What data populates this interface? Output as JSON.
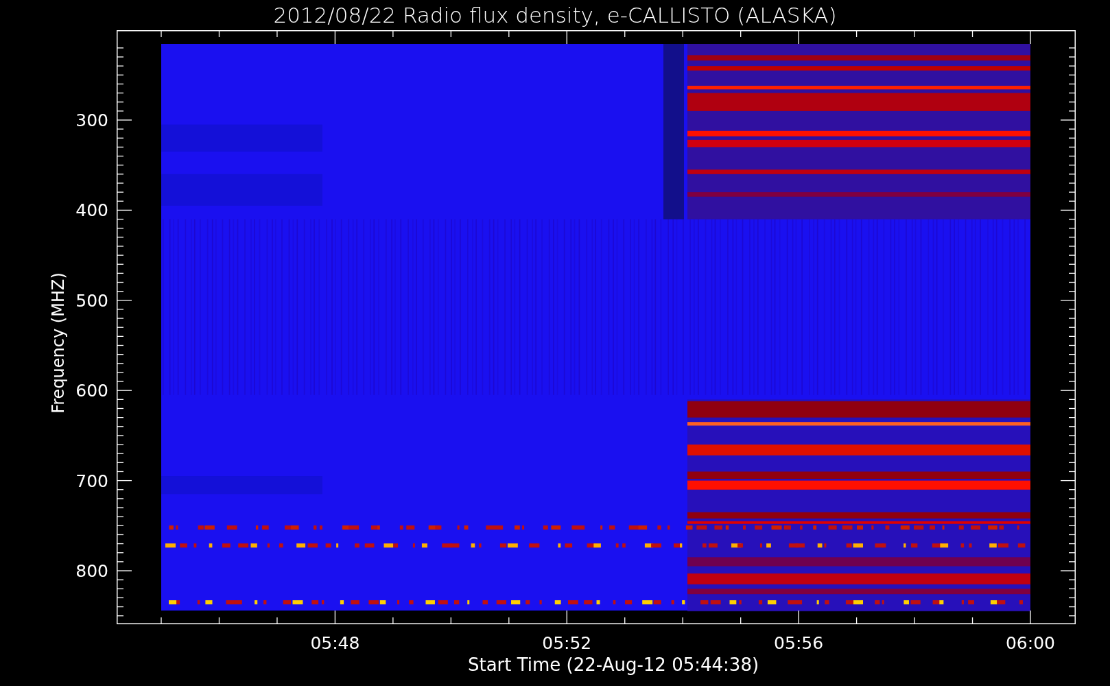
{
  "title": "2012/08/22  Radio flux density, e-CALLISTO (ALASKA)",
  "plot": {
    "ylabel": "Frequency (MHZ)",
    "xlabel": "Start Time (22-Aug-12 05:44:38)",
    "xticks": [
      "05:48",
      "05:52",
      "05:56",
      "06:00"
    ],
    "yticks": [
      "300",
      "400",
      "500",
      "600",
      "700",
      "800"
    ]
  }
}
